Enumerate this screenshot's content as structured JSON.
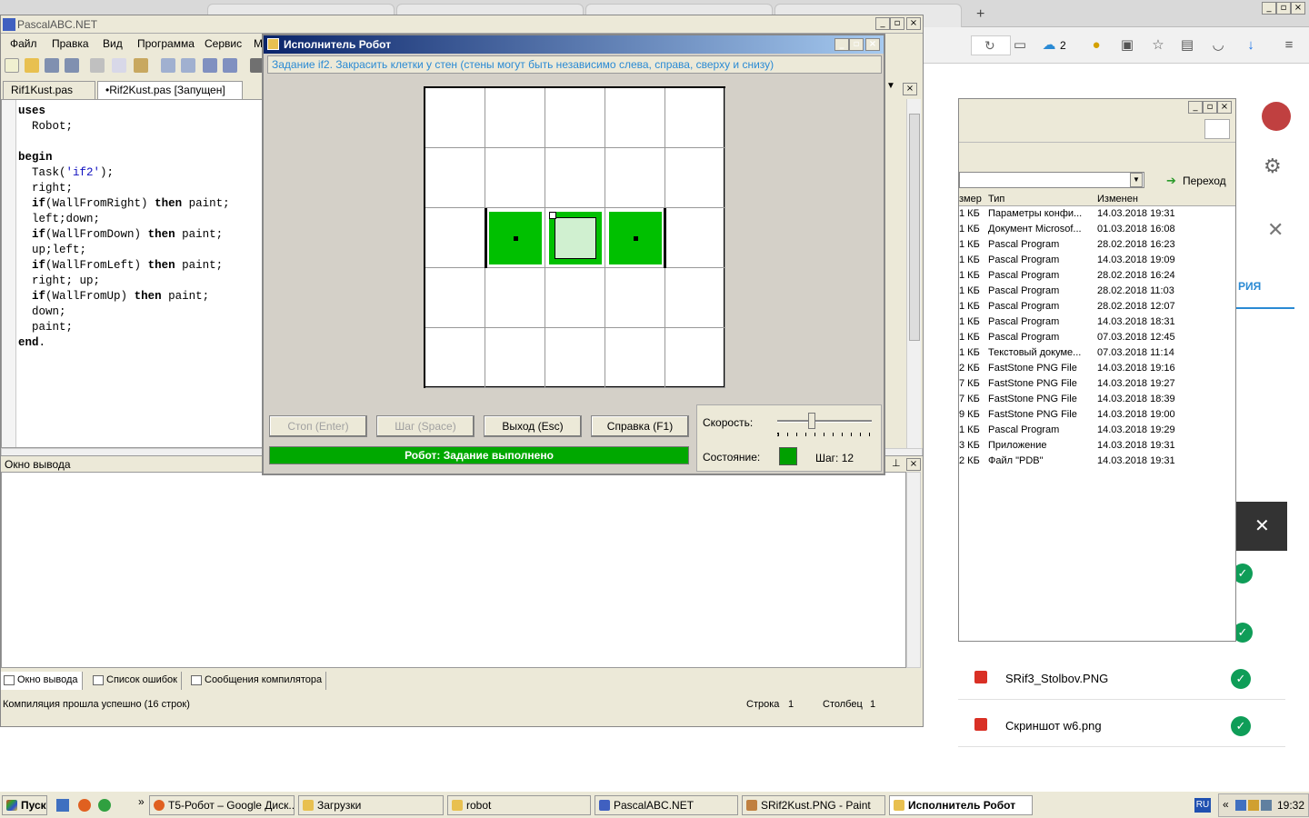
{
  "pascal": {
    "title": "PascalABC.NET",
    "menu": [
      "Файл",
      "Правка",
      "Вид",
      "Программа",
      "Сервис",
      "М"
    ],
    "editor_tabs": [
      "Rif1Kust.pas",
      "•Rif2Kust.pas [Запущен]"
    ],
    "output_header": "Окно вывода",
    "bottom_tabs": [
      "Окно вывода",
      "Список ошибок",
      "Сообщения компилятора"
    ],
    "status_text": "Компиляция прошла успешно (16 строк)",
    "row_label": "Строка",
    "row_value": "1",
    "col_label": "Столбец",
    "col_value": "1"
  },
  "code_lines": [
    "uses",
    "  Robot;",
    "",
    "begin",
    "  Task('if2');",
    "  right;",
    "  if(WallFromRight) then paint;",
    "  left;down;",
    "  if(WallFromDown) then paint;",
    "  up;left;",
    "  if(WallFromLeft) then paint;",
    "  right; up;",
    "  if(WallFromUp) then paint;",
    "  down;",
    "  paint;",
    "end."
  ],
  "robot": {
    "title": "Исполнитель Робот",
    "task": "Задание if2. Закрасить клетки у стен (стены могут быть независимо слева, справа, сверху и снизу)",
    "buttons": {
      "stop": "Стоп (Enter)",
      "step": "Шаг (Space)",
      "exit": "Выход (Esc)",
      "help": "Справка (F1)"
    },
    "status_bar": "Робот: Задание выполнено",
    "speed_label": "Скорость:",
    "state_label": "Состояние:",
    "step_label": "Шаг: 12",
    "speed_fraction": 0.35,
    "grid_cols": 5,
    "grid_rows": 5,
    "painted_cells": [
      [
        1,
        2
      ],
      [
        3,
        2
      ]
    ],
    "robot_cell": [
      2,
      2
    ]
  },
  "explorer": {
    "address_button": "Переход",
    "columns": [
      "змер",
      "Тип",
      "Изменен"
    ],
    "rows": [
      {
        "size": "1 КБ",
        "type": "Параметры конфи...",
        "date": "14.03.2018 19:31"
      },
      {
        "size": "1 КБ",
        "type": "Документ Microsof...",
        "date": "01.03.2018 16:08"
      },
      {
        "size": "1 КБ",
        "type": "Pascal Program",
        "date": "28.02.2018 16:23"
      },
      {
        "size": "1 КБ",
        "type": "Pascal Program",
        "date": "14.03.2018 19:09"
      },
      {
        "size": "1 КБ",
        "type": "Pascal Program",
        "date": "28.02.2018 16:24"
      },
      {
        "size": "1 КБ",
        "type": "Pascal Program",
        "date": "28.02.2018 11:03"
      },
      {
        "size": "1 КБ",
        "type": "Pascal Program",
        "date": "28.02.2018 12:07"
      },
      {
        "size": "1 КБ",
        "type": "Pascal Program",
        "date": "14.03.2018 18:31"
      },
      {
        "size": "1 КБ",
        "type": "Pascal Program",
        "date": "07.03.2018 12:45"
      },
      {
        "size": "1 КБ",
        "type": "Текстовый докуме...",
        "date": "07.03.2018 11:14"
      },
      {
        "size": "2 КБ",
        "type": "FastStone PNG File",
        "date": "14.03.2018 19:16"
      },
      {
        "size": "7 КБ",
        "type": "FastStone PNG File",
        "date": "14.03.2018 19:27"
      },
      {
        "size": "7 КБ",
        "type": "FastStone PNG File",
        "date": "14.03.2018 18:39"
      },
      {
        "size": "9 КБ",
        "type": "FastStone PNG File",
        "date": "14.03.2018 19:00"
      },
      {
        "size": "1 КБ",
        "type": "Pascal Program",
        "date": "14.03.2018 19:29"
      },
      {
        "size": "3 КБ",
        "type": "Приложение",
        "date": "14.03.2018 19:31"
      },
      {
        "size": "2 КБ",
        "type": "Файл \"PDB\"",
        "date": "14.03.2018 19:31"
      }
    ]
  },
  "browser": {
    "ext_count": "2",
    "side_text": "РИЯ",
    "downloads": [
      "SRif3_Stolbov.PNG",
      "Скриншот w6.png"
    ]
  },
  "taskbar": {
    "start": "Пуск",
    "tasks": [
      "T5-Робот – Google Диск...",
      "Загрузки",
      "robot",
      "PascalABC.NET",
      "SRif2Kust.PNG - Paint",
      "Исполнитель Робот"
    ],
    "lang": "RU",
    "time": "19:32"
  },
  "colors": {
    "paint": "#00c000",
    "title_bar": "#0a246a",
    "progress": "#00a800",
    "task_text": "#2a8ad4"
  }
}
